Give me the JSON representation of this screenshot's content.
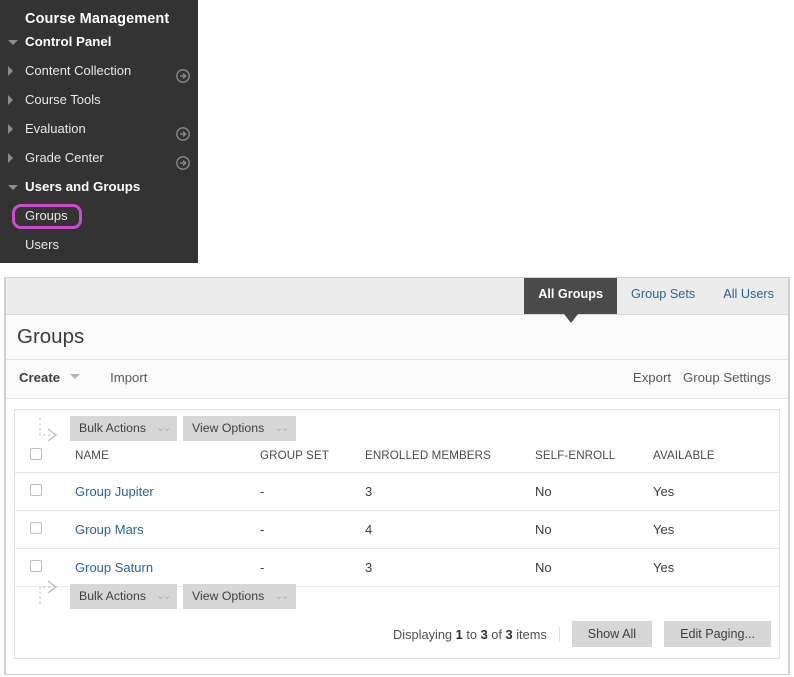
{
  "sidebar": {
    "title": "Course Management",
    "items": [
      {
        "label": "Control Panel",
        "style": "bold",
        "toggle": "down",
        "arrow": false,
        "highlight": false
      },
      {
        "label": "Content Collection",
        "style": "normal",
        "toggle": "right",
        "arrow": true,
        "highlight": false
      },
      {
        "label": "Course Tools",
        "style": "normal",
        "toggle": "right",
        "arrow": false,
        "highlight": false
      },
      {
        "label": "Evaluation",
        "style": "normal",
        "toggle": "right",
        "arrow": true,
        "highlight": false
      },
      {
        "label": "Grade Center",
        "style": "normal",
        "toggle": "right",
        "arrow": true,
        "highlight": false
      },
      {
        "label": "Users and Groups",
        "style": "bold",
        "toggle": "down",
        "arrow": false,
        "highlight": false
      },
      {
        "label": "Groups",
        "style": "normal",
        "toggle": "none",
        "arrow": false,
        "highlight": true
      },
      {
        "label": "Users",
        "style": "normal",
        "toggle": "none",
        "arrow": false,
        "highlight": false
      }
    ],
    "highlight_color": "#cb4dcb",
    "background_color": "#333333"
  },
  "tabs": [
    {
      "label": "All Groups",
      "active": true
    },
    {
      "label": "Group Sets",
      "active": false
    },
    {
      "label": "All Users",
      "active": false
    }
  ],
  "page": {
    "title": "Groups"
  },
  "actionbar": {
    "create_label": "Create",
    "create_chevron": "chevron-down-icon",
    "import_label": "Import",
    "export_label": "Export",
    "group_settings_label": "Group Settings"
  },
  "toolbar": {
    "bulk_actions_label": "Bulk Actions",
    "view_options_label": "View Options",
    "dropdown_glyph": "⌄⌄"
  },
  "table": {
    "columns": [
      "NAME",
      "GROUP SET",
      "ENROLLED MEMBERS",
      "SELF-ENROLL",
      "AVAILABLE"
    ],
    "rows": [
      {
        "name": "Group Jupiter",
        "group_set": "-",
        "enrolled_members": "3",
        "self_enroll": "No",
        "available": "Yes"
      },
      {
        "name": "Group Mars",
        "group_set": "-",
        "enrolled_members": "4",
        "self_enroll": "No",
        "available": "Yes"
      },
      {
        "name": "Group Saturn",
        "group_set": "-",
        "enrolled_members": "3",
        "self_enroll": "No",
        "available": "Yes"
      }
    ],
    "link_color": "#2a6496"
  },
  "paging": {
    "displaying_prefix": "Displaying",
    "from": "1",
    "to_word": "to",
    "to": "3",
    "of_word": "of",
    "total": "3",
    "items_word": "items",
    "show_all_label": "Show All",
    "edit_paging_label": "Edit Paging..."
  }
}
